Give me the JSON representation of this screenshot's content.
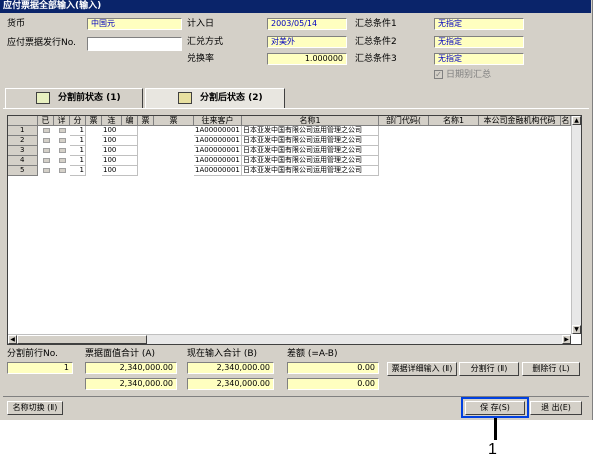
{
  "window": {
    "title": "应付票据全部输入(输入)"
  },
  "header": {
    "currency_label": "货币",
    "currency_value": "中国元",
    "note_no_label": "应付票据发行No.",
    "note_no_value": "",
    "booking_date_label": "计入日",
    "booking_date_value": "2003/05/14",
    "fx_method_label": "汇兑方式",
    "fx_method_value": "对美外",
    "fx_rate_label": "兑换率",
    "fx_rate_value": "1.000000",
    "cond1_label": "汇总条件1",
    "cond1_value": "无指定",
    "cond2_label": "汇总条件2",
    "cond2_value": "无指定",
    "cond3_label": "汇总条件3",
    "cond3_value": "无指定",
    "date_summary_label": "日期别汇总",
    "date_summary_checked": true
  },
  "tabs": [
    {
      "label": "分割前状态 (1)"
    },
    {
      "label": "分割后状态 (2)"
    }
  ],
  "grid": {
    "columns": [
      "已",
      "详",
      "分",
      "票",
      "连",
      "编",
      "票",
      "票",
      "往来客户",
      "名称1",
      "部门代码(",
      "名称1",
      "本公司金融机构代码",
      "名"
    ],
    "rows": [
      {
        "no": "1",
        "split": "1",
        "seq": "100",
        "partner": "1A00000001",
        "name": "日本亚发中国有限公司运用管理之公司"
      },
      {
        "no": "2",
        "split": "1",
        "seq": "100",
        "partner": "1A00000001",
        "name": "日本亚发中国有限公司运用管理之公司"
      },
      {
        "no": "3",
        "split": "1",
        "seq": "100",
        "partner": "1A00000001",
        "name": "日本亚发中国有限公司运用管理之公司"
      },
      {
        "no": "4",
        "split": "1",
        "seq": "100",
        "partner": "1A00000001",
        "name": "日本亚发中国有限公司运用管理之公司"
      },
      {
        "no": "5",
        "split": "1",
        "seq": "100",
        "partner": "1A00000001",
        "name": "日本亚发中国有限公司运用管理之公司"
      }
    ]
  },
  "footer": {
    "split_row_label": "分割前行No.",
    "split_row_value": "1",
    "face_total_label": "票据面值合计 (A)",
    "face_total_1": "2,340,000.00",
    "face_total_2": "2,340,000.00",
    "input_total_label": "现在输入合计 (B)",
    "input_total_1": "2,340,000.00",
    "input_total_2": "2,340,000.00",
    "diff_label": "差额 (=A-B)",
    "diff_1": "0.00",
    "diff_2": "0.00",
    "detail_btn": "票据详细输入 (Ⅱ)",
    "split_btn": "分割行 (Ⅱ)",
    "delete_btn": "删除行 (L)"
  },
  "bottom": {
    "name_switch_btn": "名称切换 (Ⅱ)",
    "save_btn": "保  存(S)",
    "exit_btn": "退  出(E)"
  },
  "callout": {
    "number": "1"
  },
  "colors": {
    "title_bar": "#0a246a",
    "highlight": "#0040e0",
    "field_yellow": "#ffffc0"
  }
}
